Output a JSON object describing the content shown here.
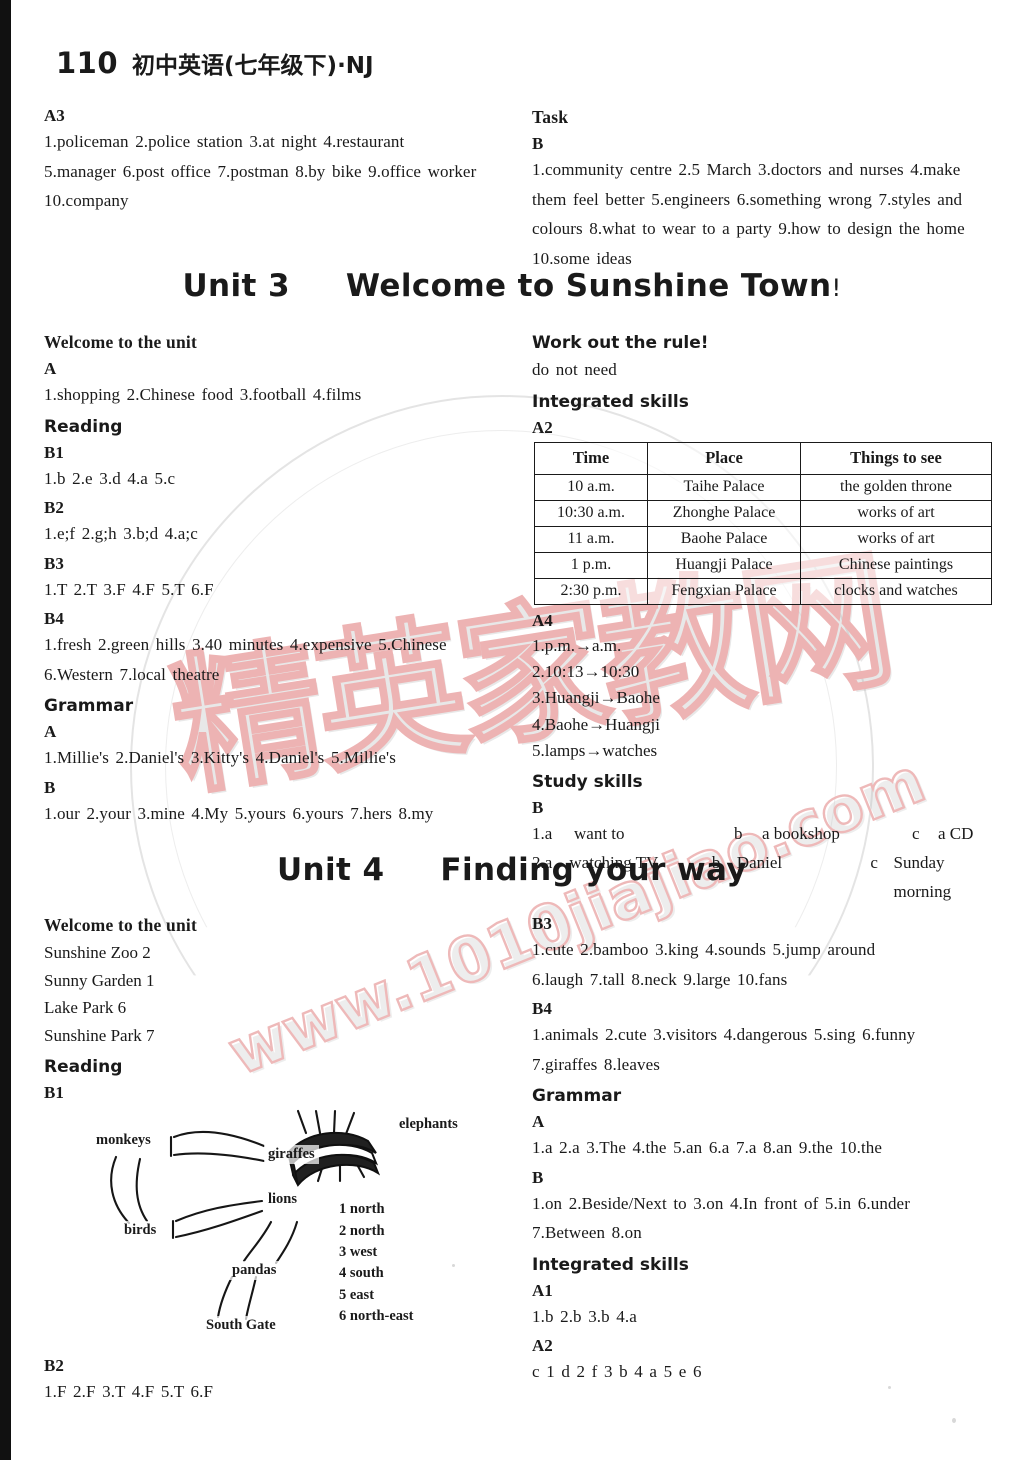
{
  "page": {
    "number": "110",
    "header_cn": "初中英语(七年级下)·NJ"
  },
  "watermark": {
    "chinese": "精英家教网",
    "url": "www.1010jiajiao.com"
  },
  "left_column_top": {
    "section_a3": {
      "label": "A3",
      "lines": [
        "1.policeman   2.police station   3.at night   4.restaurant",
        "5.manager   6.post office   7.postman   8.by bike   9.office worker",
        "10.company"
      ]
    }
  },
  "right_column_top": {
    "task": {
      "heading": "Task",
      "label": "B",
      "lines": [
        "1.community centre   2.5 March   3.doctors and nurses   4.make",
        "them feel better   5.engineers   6.something wrong   7.styles and",
        "colours   8.what to wear to a party   9.how to design the home",
        "10.some ideas"
      ]
    }
  },
  "unit3": {
    "title_prefix": "Unit 3",
    "title_main": "Welcome to Sunshine Town",
    "title_bang": "!",
    "left": {
      "welcome_heading": "Welcome to the unit",
      "welcome_label": "A",
      "welcome_answers": "1.shopping   2.Chinese food   3.football   4.films",
      "reading_heading": "Reading",
      "b1_label": "B1",
      "b1_answers": "1.b   2.e   3.d   4.a   5.c",
      "b2_label": "B2",
      "b2_answers": "1.e;f   2.g;h   3.b;d   4.a;c",
      "b3_label": "B3",
      "b3_answers": "1.T   2.T   3.F   4.F   5.T   6.F",
      "b4_label": "B4",
      "b4_answers_1": "1.fresh   2.green hills   3.40 minutes   4.expensive   5.Chinese",
      "b4_answers_2": "6.Western   7.local theatre",
      "grammar_heading": "Grammar",
      "grammar_a_label": "A",
      "grammar_a_answers": "1.Millie's   2.Daniel's   3.Kitty's   4.Daniel's   5.Millie's",
      "grammar_b_label": "B",
      "grammar_b_answers": "1.our   2.your   3.mine   4.My   5.yours   6.yours   7.hers   8.my"
    },
    "right": {
      "work_out_heading": "Work out the rule!",
      "work_out_answer": "do not need",
      "integrated_heading": "Integrated skills",
      "a2_label": "A2",
      "a2_table": {
        "columns": [
          "Time",
          "Place",
          "Things to see"
        ],
        "rows": [
          [
            "10 a.m.",
            "Taihe Palace",
            "the golden throne"
          ],
          [
            "10:30 a.m.",
            "Zhonghe Palace",
            "works of art"
          ],
          [
            "11 a.m.",
            "Baohe Palace",
            "works of art"
          ],
          [
            "1 p.m.",
            "Huangji Palace",
            "Chinese paintings"
          ],
          [
            "2:30 p.m.",
            "Fengxian Palace",
            "clocks and watches"
          ]
        ]
      },
      "a4_label": "A4",
      "a4_answers": [
        "1.p.m.→a.m.",
        "2.10:13→10:30",
        "3.Huangji→Baohe",
        "4.Baohe→Huangji",
        "5.lamps→watches"
      ],
      "study_skills_heading": "Study skills",
      "study_skills_label": "B",
      "study_skills_rows": [
        {
          "n": "1.a",
          "a": "want to",
          "bk": "b",
          "b": "a bookshop",
          "ck": "c",
          "c": "a CD"
        },
        {
          "n": "2.a",
          "a": "watching TV",
          "bk": "b",
          "b": "Daniel",
          "ck": "c",
          "c": "Sunday morning"
        }
      ]
    }
  },
  "unit4": {
    "title_prefix": "Unit 4",
    "title_main": "Finding your way",
    "left": {
      "welcome_heading": "Welcome to the unit",
      "welcome_answers": [
        "Sunshine Zoo 2",
        "Sunny Garden 1",
        "Lake Park 6",
        "Sunshine Park 7"
      ],
      "reading_heading": "Reading",
      "b1_label": "B1",
      "diagram": {
        "nodes": [
          "monkeys",
          "giraffes",
          "elephants",
          "birds",
          "lions",
          "pandas",
          "South Gate"
        ],
        "directions": [
          "1 north",
          "2 north",
          "3 west",
          "4 south",
          "5 east",
          "6 north-east"
        ]
      },
      "b2_label": "B2",
      "b2_answers": "1.F   2.F   3.T   4.F   5.T   6.F"
    },
    "right": {
      "b3_label": "B3",
      "b3_answers_1": "1.cute   2.bamboo   3.king   4.sounds   5.jump around",
      "b3_answers_2": "6.laugh   7.tall   8.neck   9.large   10.fans",
      "b4_label": "B4",
      "b4_answers_1": "1.animals   2.cute   3.visitors   4.dangerous   5.sing   6.funny",
      "b4_answers_2": "7.giraffes   8.leaves",
      "grammar_heading": "Grammar",
      "grammar_a_label": "A",
      "grammar_a_answers": "1.a   2.a   3.The   4.the   5.an   6.a   7.a   8.an   9.the   10.the",
      "grammar_b_label": "B",
      "grammar_b_answers_1": "1.on   2.Beside/Next to   3.on   4.In front of   5.in   6.under",
      "grammar_b_answers_2": "7.Between   8.on",
      "integrated_heading": "Integrated skills",
      "a1_label": "A1",
      "a1_answers": "1.b   2.b   3.b   4.a",
      "a2_label": "A2",
      "a2_answers": "c 1   d 2   f 3   b 4   a 5   e 6"
    }
  }
}
